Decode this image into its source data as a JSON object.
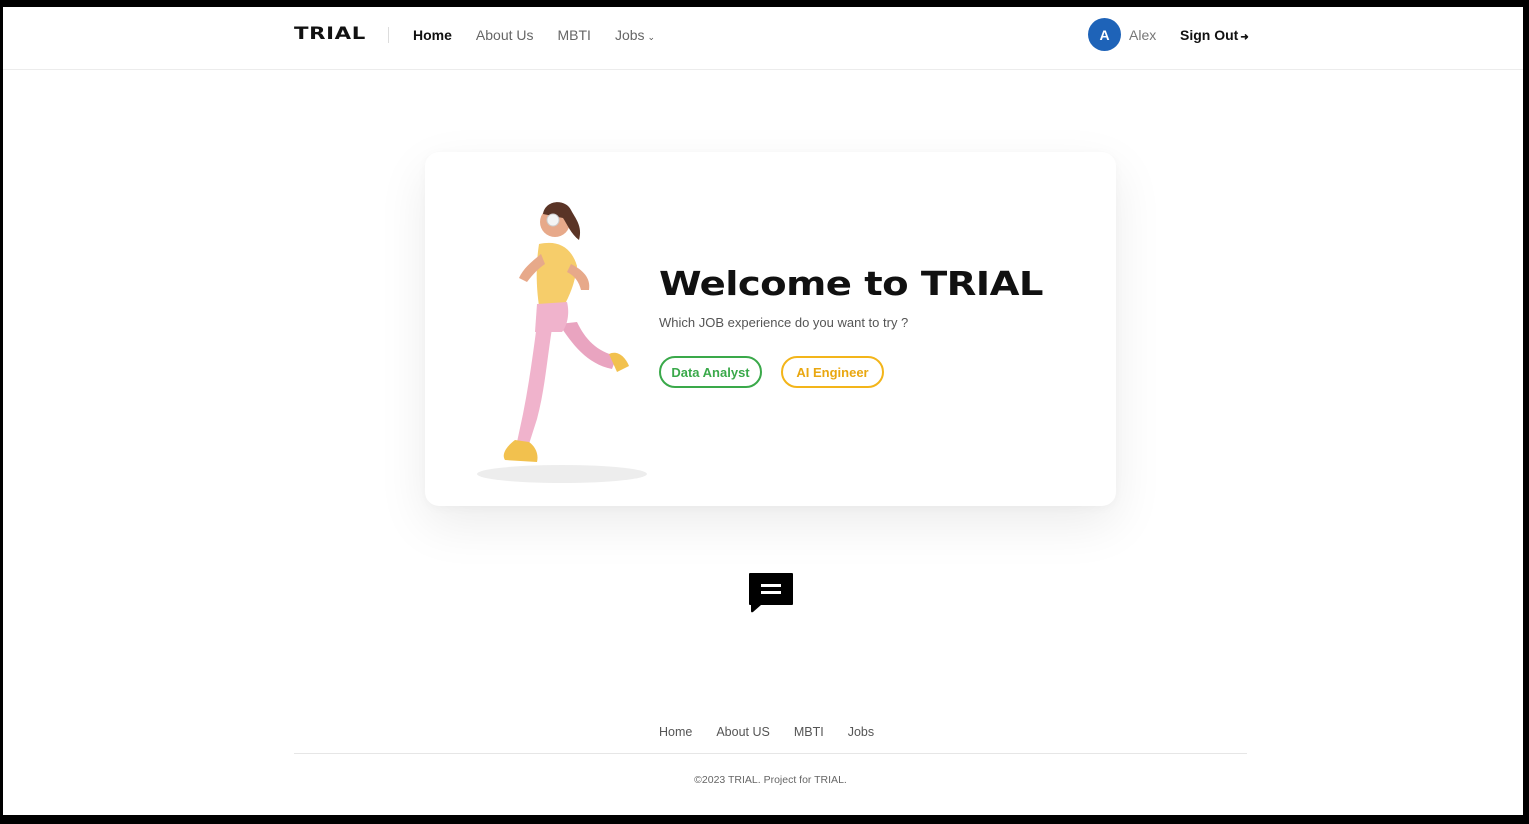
{
  "header": {
    "logo": "TRIAL",
    "nav": [
      {
        "label": "Home",
        "active": true
      },
      {
        "label": "About Us",
        "active": false
      },
      {
        "label": "MBTI",
        "active": false
      },
      {
        "label": "Jobs",
        "active": false,
        "dropdown": true
      }
    ],
    "user": {
      "initial": "A",
      "name": "Alex",
      "avatar_color": "#1e63b8"
    },
    "sign_out": "Sign Out"
  },
  "hero": {
    "title": "Welcome to TRIAL",
    "subtitle": "Which JOB experience do you want to try ?",
    "buttons": [
      {
        "label": "Data Analyst",
        "color": "#3aa94a"
      },
      {
        "label": "AI Engineer",
        "color": "#f3b51a"
      }
    ],
    "illustration": "running-woman-3d"
  },
  "chat": {
    "icon": "chat-bubble-icon"
  },
  "footer": {
    "links": [
      "Home",
      "About US",
      "MBTI",
      "Jobs"
    ],
    "copyright": "©2023 TRIAL. Project for TRIAL."
  }
}
